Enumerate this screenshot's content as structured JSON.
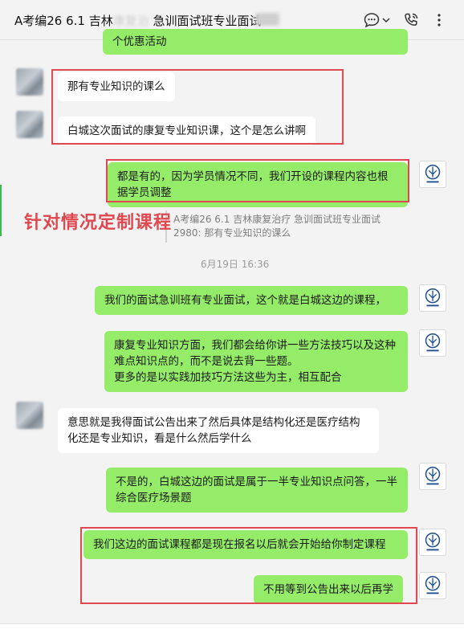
{
  "window": {
    "title": "A考编26 6.1 吉林",
    "title_rest": "急训面试班专业面试"
  },
  "icons": {
    "chat_bubble": "chat-more-icon",
    "dropdown": "chevron-down-icon",
    "call": "phone-call-icon",
    "more": "more-vertical-icon"
  },
  "colors": {
    "my_bubble": "#95ec69",
    "other_bubble": "#ffffff",
    "highlight_box": "#e0474f"
  },
  "messages": {
    "top_partial": "个优惠活动",
    "m1": "那有专业知识的课么",
    "m2": "白城这次面试的康复专业知识课，这个是怎么讲啊",
    "m3": "都是有的，因为学员情况不同，我们开设的课程内容也根据学员调整",
    "quote": "A考编26 6.1 吉林康复治疗 急训面试班专业面试2980: 那有专业知识的课么",
    "timestamp": "6月19日 16:36",
    "m4": "我们的面试急训班有专业面试，这个就是白城这边的课程，",
    "m5_line1": "康复专业知识方面，我们都会给你讲一些方法技巧以及这种难点知识点的，而不是说去背一些题。",
    "m5_line2": "更多的是以实践加技巧方法这些为主，相互配合",
    "m6": "意思就是我得面试公告出来了然后具体是结构化还是医疗结构化还是专业知识，看是什么然后学什么",
    "m7": "不是的，白城这边的面试是属于一半专业知识点问答，一半综合医疗场景题",
    "m8": "我们这边的面试课程都是现在报名以后就会开始给你制定课程",
    "m9": "不用等到公告出来以后再学"
  },
  "annotation": {
    "caption": "针对情况定制课程"
  }
}
